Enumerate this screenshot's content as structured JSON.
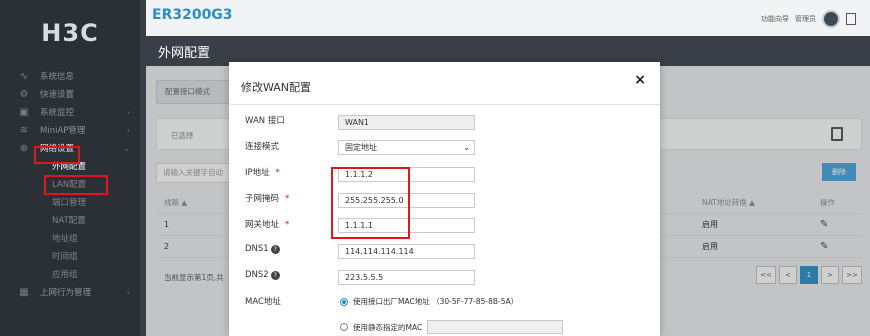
{
  "sidebar": {
    "logo": "H3C",
    "items": [
      {
        "icon": "pulse-icon",
        "label": "系统信息",
        "chev": ""
      },
      {
        "icon": "wizard-icon",
        "label": "快速设置",
        "chev": ""
      },
      {
        "icon": "monitor-icon",
        "label": "系统监控",
        "chev": "›"
      },
      {
        "icon": "wifi-icon",
        "label": "MiniAP管理",
        "chev": "›"
      },
      {
        "icon": "globe-icon",
        "label": "网络设置",
        "chev": "⌄"
      }
    ],
    "subitems": [
      "外网配置",
      "LAN配置",
      "端口管理",
      "NAT配置",
      "地址组",
      "时间组",
      "应用组"
    ],
    "bottom_item": {
      "icon": "behavior-icon",
      "label": "上网行为管理",
      "chev": "›"
    }
  },
  "header": {
    "device_name": "ER3200G3",
    "nav_link": "功能向导",
    "admin": "管理员"
  },
  "page_title": "外网配置",
  "background": {
    "tab": "配置接口模式",
    "filter_label": "已选择",
    "search_placeholder": "请输入关键字自动",
    "delete_button": "删除",
    "columns": [
      "线路 ▲",
      "NAT地址转换 ▲",
      "操作"
    ],
    "rows": [
      {
        "line": "1",
        "nat": "启用"
      },
      {
        "line": "2",
        "nat": "启用"
      }
    ],
    "pager_text": "当前显示第1页,共",
    "pager_buttons": [
      "<<",
      "<",
      "1",
      ">",
      ">>"
    ]
  },
  "modal": {
    "title": "修改WAN配置",
    "close": "×",
    "fields": {
      "wan_port": {
        "label": "WAN 接口",
        "value": "WAN1"
      },
      "conn_mode": {
        "label": "连接模式",
        "value": "固定地址"
      },
      "ip": {
        "label": "IP地址",
        "value": "1.1.1.2"
      },
      "mask": {
        "label": "子网掩码",
        "value": "255.255.255.0"
      },
      "gateway": {
        "label": "网关地址",
        "value": "1.1.1.1"
      },
      "dns1": {
        "label": "DNS1",
        "value": "114.114.114.114"
      },
      "dns2": {
        "label": "DNS2",
        "value": "223.5.5.5"
      },
      "mac": {
        "label": "MAC地址"
      }
    },
    "mac_option_factory": "使用接口出厂MAC地址 （30-5F-77-85-8B-5A）",
    "mac_option_static": "使用静态指定的MAC",
    "required_star": "*",
    "help": "?"
  },
  "colors": {
    "accent": "#2b8ec6",
    "highlight": "#e0161b",
    "sidebar": "#2b2f36"
  }
}
